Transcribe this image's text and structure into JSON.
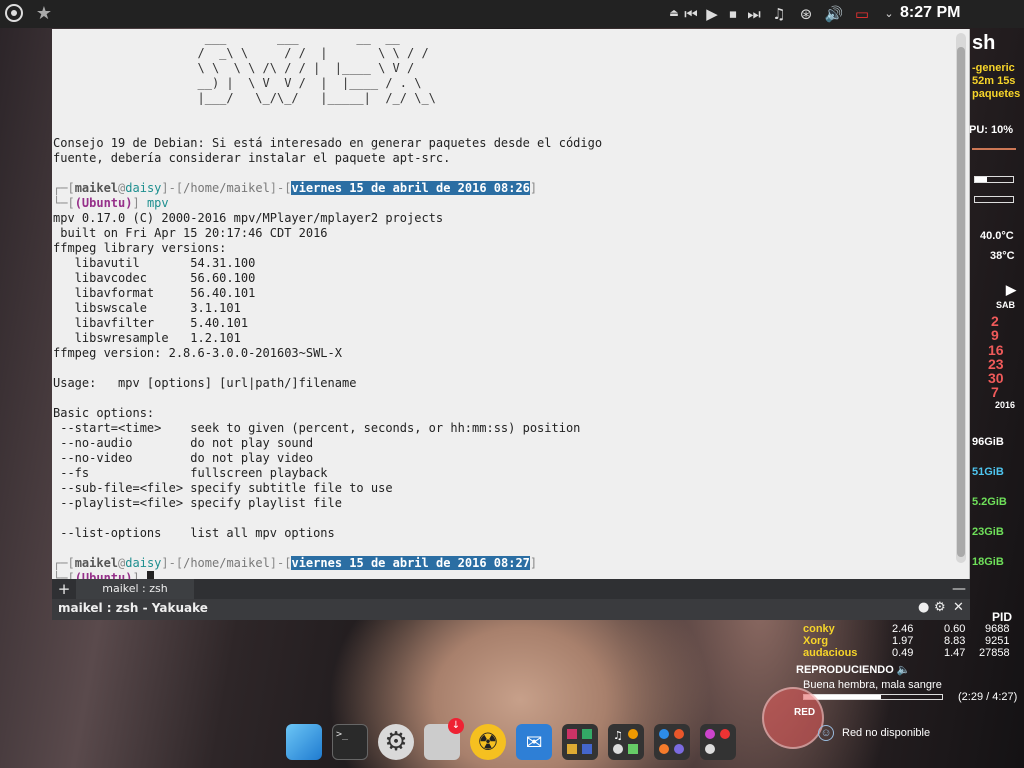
{
  "topbar": {
    "clock": "8:27 PM"
  },
  "terminal": {
    "banner": [
      "                     ___       ___        __  __",
      "                    /  _\\ \\     / /  |       \\ \\ / /",
      "                    \\ \\  \\ \\ /\\ / / |  |____ \\ V /",
      "                    __) |  \\ V  V /  |  |____ / . \\",
      "                    |___/   \\_/\\_/   |_____|  /_/ \\_\\"
    ],
    "tip_line1": "Consejo 19 de Debian: Si está interesado en generar paquetes desde el código",
    "tip_line2": "fuente, debería considerar instalar el paquete apt-src.",
    "prompt1": {
      "user": "maikel",
      "host": "daisy",
      "path": "/home/maikel",
      "date": "viernes 15 de abril de 2016 08:26",
      "os": "(Ubuntu)",
      "command": "mpv"
    },
    "output": [
      "mpv 0.17.0 (C) 2000-2016 mpv/MPlayer/mplayer2 projects",
      " built on Fri Apr 15 20:17:46 CDT 2016",
      "ffmpeg library versions:",
      "   libavutil       54.31.100",
      "   libavcodec      56.60.100",
      "   libavformat     56.40.101",
      "   libswscale      3.1.101",
      "   libavfilter     5.40.101",
      "   libswresample   1.2.101",
      "ffmpeg version: 2.8.6-3.0.0-201603~SWL-X",
      "",
      "Usage:   mpv [options] [url|path/]filename",
      "",
      "Basic options:",
      " --start=<time>    seek to given (percent, seconds, or hh:mm:ss) position",
      " --no-audio        do not play sound",
      " --no-video        do not play video",
      " --fs              fullscreen playback",
      " --sub-file=<file> specify subtitle file to use",
      " --playlist=<file> specify playlist file",
      "",
      " --list-options    list all mpv options",
      ""
    ],
    "prompt2": {
      "user": "maikel",
      "host": "daisy",
      "path": "/home/maikel",
      "date": "viernes 15 de abril de 2016 08:27",
      "os": "(Ubuntu)"
    }
  },
  "tabs": {
    "plus": "+",
    "active_label": "maikel : zsh",
    "minimize": "—"
  },
  "window": {
    "title": "maikel : zsh - Yakuake"
  },
  "conky": {
    "sh": "sh",
    "kernel": "-generic",
    "uptime": "52m 15s",
    "packages": "paquetes",
    "cpu": "PU: 10%",
    "temp1": "40.0°C",
    "temp2": "38°C",
    "day": "SAB",
    "dates": [
      "2",
      "9",
      "16",
      "23",
      "30",
      "7"
    ],
    "year": "2016",
    "disks": [
      "96GiB",
      "51GiB",
      "5.2GiB",
      "23GiB",
      "18GiB"
    ]
  },
  "processes": {
    "pid_header": "PID",
    "rows": [
      {
        "name": "conky",
        "cpu": "2.46",
        "mem": "0.60",
        "pid": "9688"
      },
      {
        "name": "Xorg",
        "cpu": "1.97",
        "mem": "8.83",
        "pid": "9251"
      },
      {
        "name": "audacious",
        "cpu": "0.49",
        "mem": "1.47",
        "pid": "27858"
      }
    ]
  },
  "player": {
    "status": "REPRODUCIENDO",
    "song": "Buena hembra, mala sangre",
    "time": "(2:29 / 4:27)",
    "progress": 0.56
  },
  "network": {
    "badge": "RED",
    "status": "Red no disponible"
  },
  "colors": {
    "selection": "#2b6ea3",
    "prompt_user": "#96308a",
    "prompt_host": "#1d8f8f"
  }
}
